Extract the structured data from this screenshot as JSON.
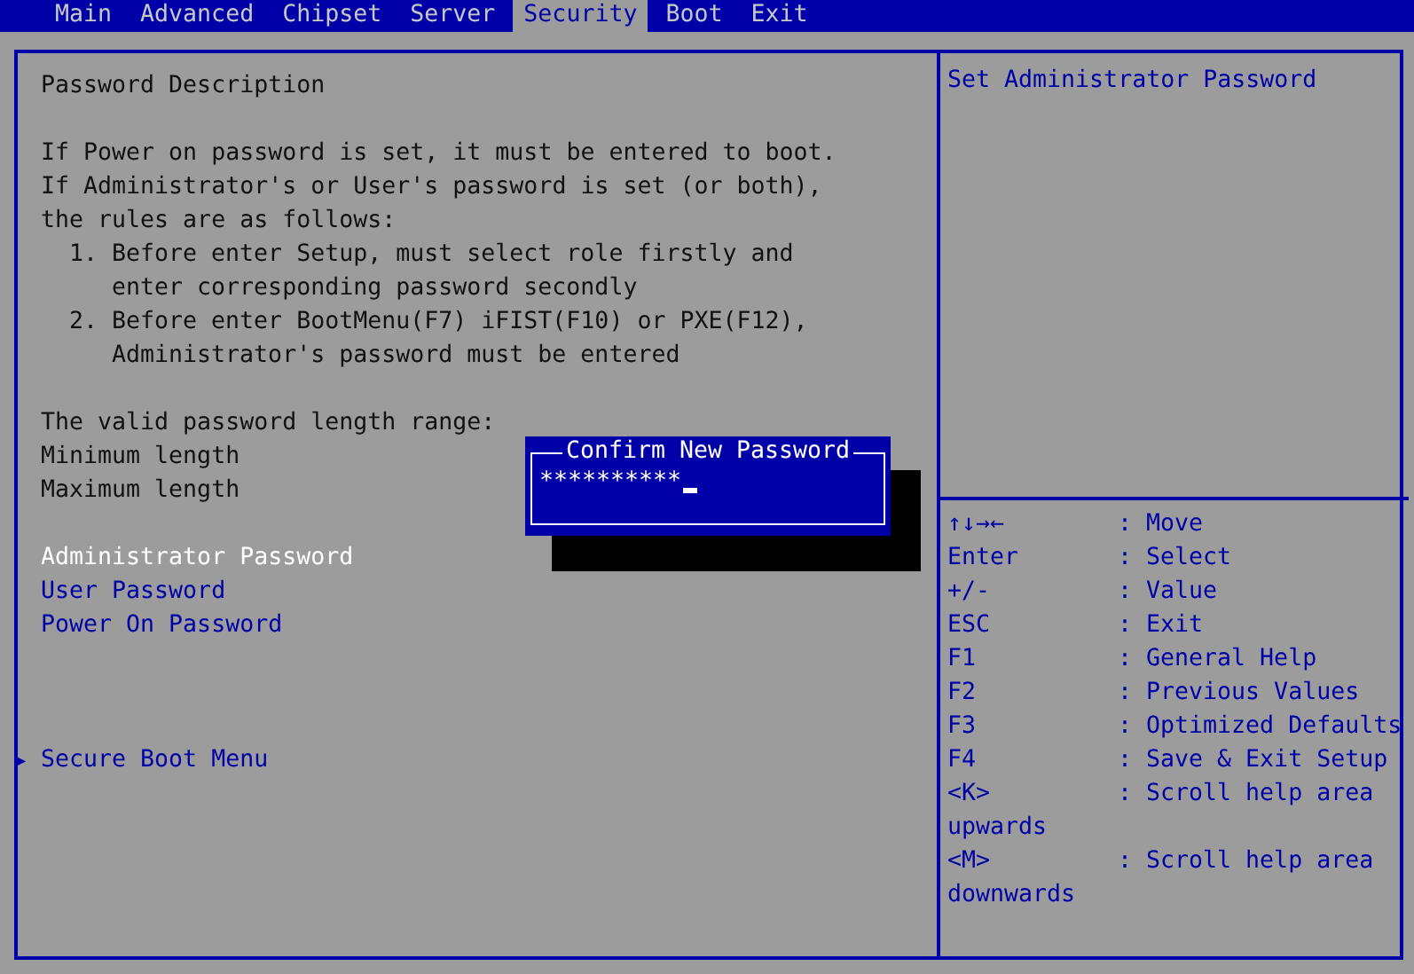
{
  "tabs": [
    {
      "label": "Main",
      "selected": false
    },
    {
      "label": "Advanced",
      "selected": false
    },
    {
      "label": "Chipset",
      "selected": false
    },
    {
      "label": "Server",
      "selected": false
    },
    {
      "label": "Security",
      "selected": true
    },
    {
      "label": "Boot",
      "selected": false
    },
    {
      "label": "Exit",
      "selected": false
    }
  ],
  "description": {
    "title": "Password Description",
    "paragraph_lines": [
      "If Power on password is set, it must be entered to boot.",
      "If Administrator's or User's password is set (or both),",
      "the rules are as follows:"
    ],
    "rules": [
      {
        "number": "1.",
        "lines": [
          "Before enter Setup, must select role firstly and",
          "enter corresponding password secondly"
        ]
      },
      {
        "number": "2.",
        "lines": [
          "Before enter BootMenu(F7) iFIST(F10) or PXE(F12),",
          "Administrator's password must be entered"
        ]
      }
    ]
  },
  "length_range": {
    "label": "The valid password length range:",
    "fields": [
      "Minimum length",
      "Maximum length"
    ]
  },
  "password_items": [
    {
      "label": "Administrator Password",
      "selected": true
    },
    {
      "label": "User Password",
      "selected": false
    },
    {
      "label": "Power On Password",
      "selected": false
    }
  ],
  "submenus": [
    {
      "marker": "▶",
      "label": "Secure Boot Menu"
    }
  ],
  "dialog": {
    "title": "Confirm New Password",
    "value": "**********"
  },
  "help_text": "Set Administrator Password",
  "keys": [
    {
      "key": "↑↓→←",
      "action": ": Move"
    },
    {
      "key": "Enter",
      "action": ": Select"
    },
    {
      "key": "+/-",
      "action": ": Value"
    },
    {
      "key": "ESC",
      "action": ": Exit"
    },
    {
      "key": "F1",
      "action": ": General Help"
    },
    {
      "key": "F2",
      "action": ": Previous Values"
    },
    {
      "key": "F3",
      "action": ": Optimized Defaults"
    },
    {
      "key": "F4",
      "action": ": Save & Exit Setup"
    },
    {
      "key": "<K>",
      "action": ": Scroll help area",
      "continuation": "upwards"
    },
    {
      "key": "<M>",
      "action": ": Scroll help area",
      "continuation": "downwards"
    }
  ]
}
